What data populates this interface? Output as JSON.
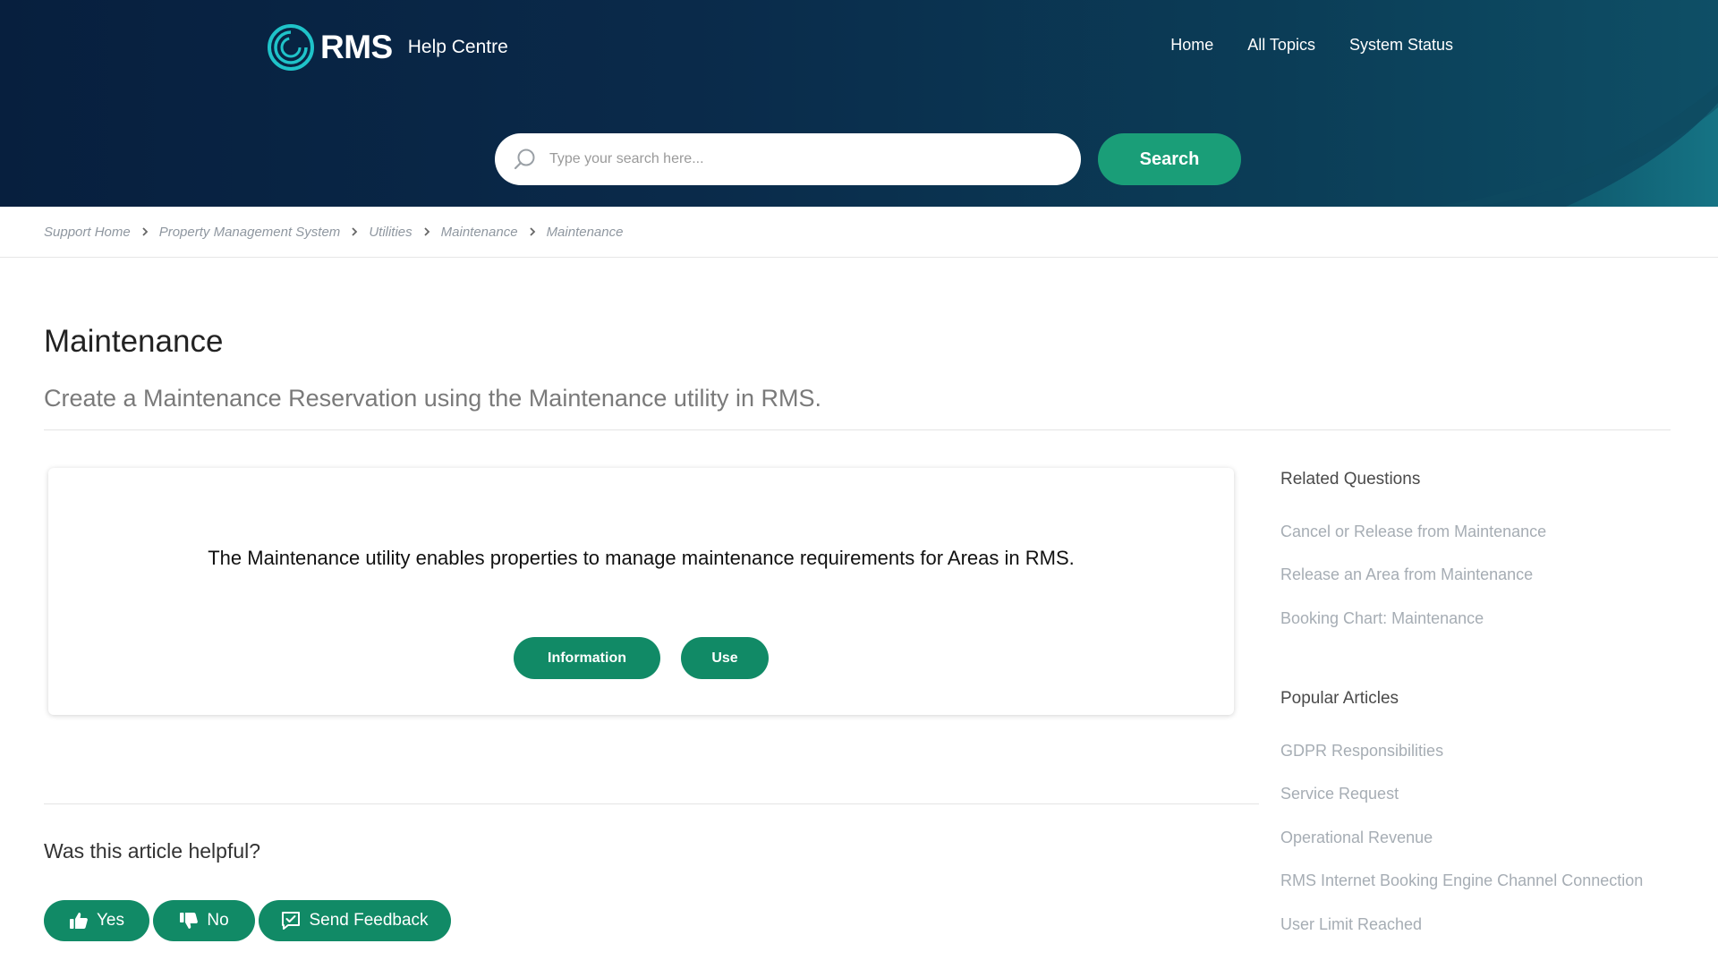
{
  "header": {
    "brand": "RMS",
    "subtitle": "Help Centre",
    "nav": [
      "Home",
      "All Topics",
      "System Status"
    ],
    "search_placeholder": "Type your search here...",
    "search_button": "Search"
  },
  "breadcrumb": [
    "Support Home",
    "Property Management System",
    "Utilities",
    "Maintenance",
    "Maintenance"
  ],
  "article": {
    "title": "Maintenance",
    "subtitle": "Create a Maintenance Reservation using the Maintenance utility in RMS.",
    "body": "The Maintenance utility enables properties to manage maintenance requirements for Areas in RMS.",
    "buttons": [
      "Information",
      "Use"
    ]
  },
  "feedback": {
    "question": "Was this article helpful?",
    "yes": "Yes",
    "no": "No",
    "send": "Send Feedback"
  },
  "sidebar": {
    "related_heading": "Related Questions",
    "related": [
      "Cancel or Release from Maintenance",
      "Release an Area from Maintenance",
      "Booking Chart: Maintenance"
    ],
    "popular_heading": "Popular Articles",
    "popular": [
      "GDPR Responsibilities",
      "Service Request",
      "Operational Revenue",
      "RMS Internet Booking Engine Channel Connection",
      "User Limit Reached"
    ]
  },
  "colors": {
    "header_dark": "#071f3e",
    "accent_green": "#118a66",
    "search_green": "#1a9e78",
    "logo_teal": "#1fc3c9"
  },
  "icons": [
    "rms-logo-icon",
    "search-icon",
    "chevron-right-icon",
    "thumbs-up-icon",
    "thumbs-down-icon",
    "feedback-icon"
  ]
}
